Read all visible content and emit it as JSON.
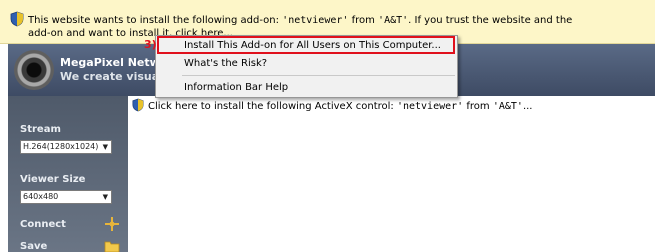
{
  "infobar": {
    "text_before": "This website wants to install the following add-on: ",
    "addon": "'netviewer'",
    "text_middle": " from ",
    "publisher": "'A&T'",
    "text_after": ". If you trust the website and the add-on and want to install it, click here..."
  },
  "header": {
    "brand_line1": "MegaPixel Network",
    "brand_line2": "We create visual te"
  },
  "sidebar": {
    "stream_label": "Stream",
    "stream_value": "H.264(1280x1024)",
    "viewer_size_label": "Viewer Size",
    "viewer_size_value": "640x480",
    "connect_label": "Connect",
    "save_label": "Save"
  },
  "activex": {
    "text_before": "Click here to install the following ActiveX control: ",
    "control": "'netviewer'",
    "text_middle": " from ",
    "publisher": "'A&T'",
    "text_after": "..."
  },
  "menu": {
    "step_marker": "3)",
    "items": [
      "Install This Add-on for All Users on This Computer...",
      "What's the Risk?",
      "Information Bar Help"
    ]
  },
  "colors": {
    "infobar_bg": "#fdf6c8",
    "highlight": "#e0101c",
    "sidebar": "#5a6575"
  }
}
